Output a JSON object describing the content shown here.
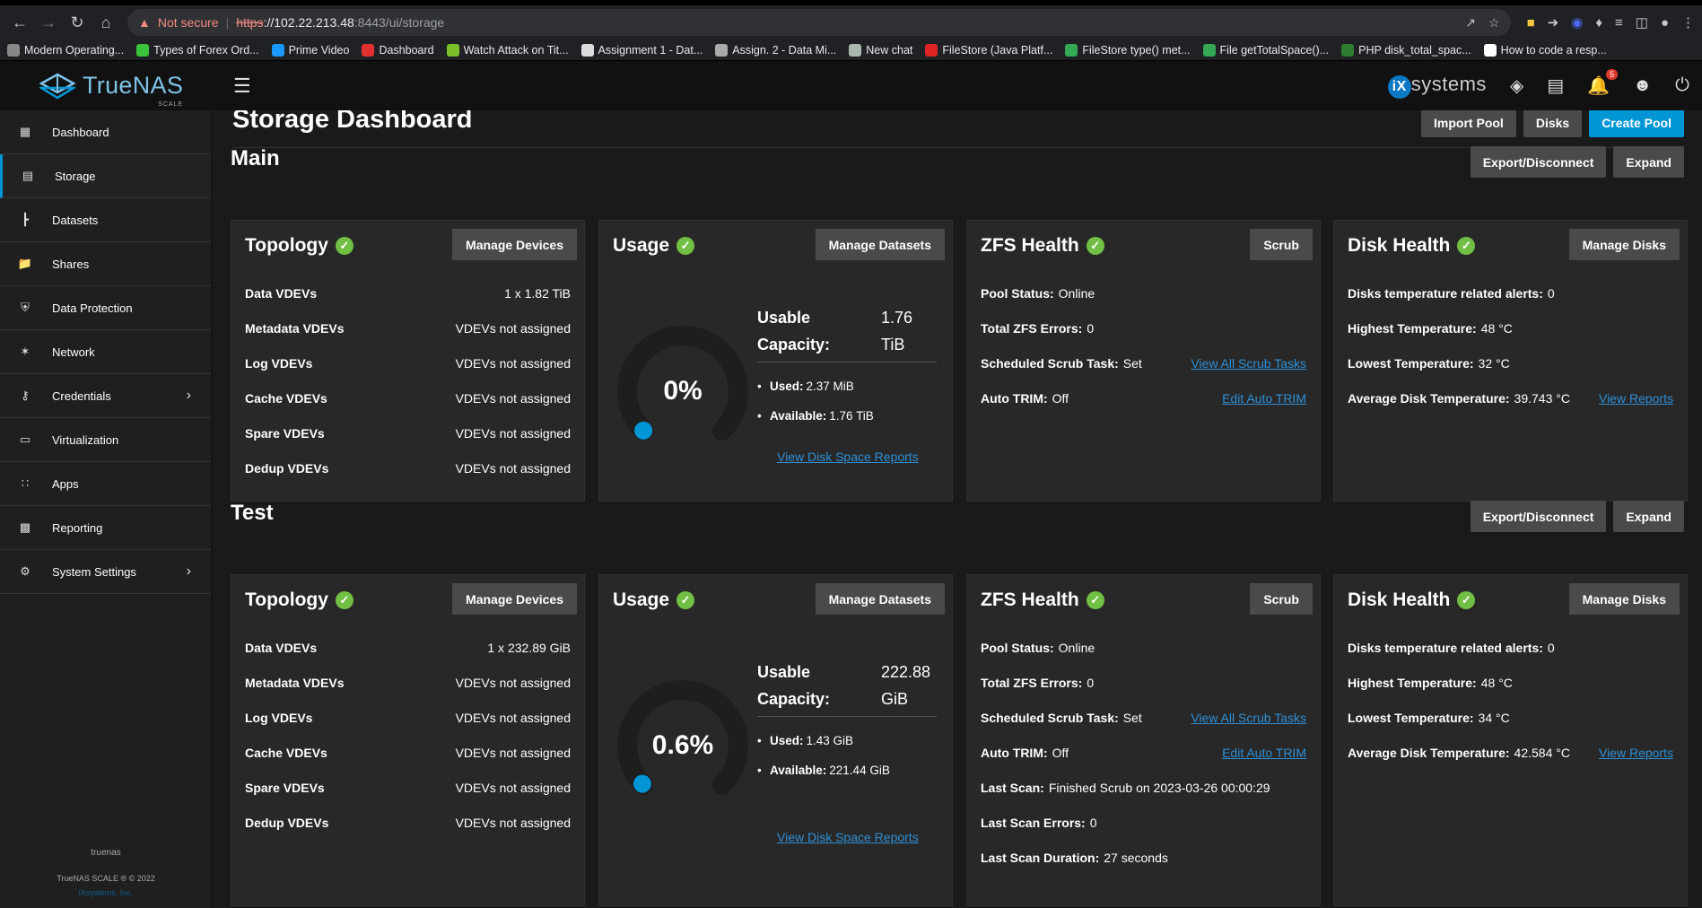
{
  "browser": {
    "not_secure": "Not secure",
    "url_proto": "https",
    "url_host": "://102.22.213.48",
    "url_rest": ":8443/ui/storage",
    "bookmarks": [
      {
        "label": "Modern Operating...",
        "color": "#888888"
      },
      {
        "label": "Types of Forex Ord...",
        "color": "#3ac23a"
      },
      {
        "label": "Prime Video",
        "color": "#1a98ff"
      },
      {
        "label": "Dashboard",
        "color": "#e03030"
      },
      {
        "label": "Watch Attack on Tit...",
        "color": "#7bbf2a"
      },
      {
        "label": "Assignment 1 - Dat...",
        "color": "#dddddd"
      },
      {
        "label": "Assign. 2 - Data Mi...",
        "color": "#aaaaaa"
      },
      {
        "label": "New chat",
        "color": "#aab8b0"
      },
      {
        "label": "FileStore (Java Platf...",
        "color": "#e02424"
      },
      {
        "label": "FileStore type() met...",
        "color": "#34a853"
      },
      {
        "label": "File getTotalSpace()...",
        "color": "#34a853"
      },
      {
        "label": "PHP disk_total_spac...",
        "color": "#2e7d32"
      },
      {
        "label": "How to code a resp...",
        "color": "#ffffff"
      }
    ]
  },
  "header": {
    "logo": "TrueNAS",
    "logo_sub": "SCALE",
    "ix_brand": "systems",
    "ix_mark": "iX",
    "notification_count": "5"
  },
  "sidebar": {
    "items": [
      {
        "label": "Dashboard",
        "icon": "dashboard-icon"
      },
      {
        "label": "Storage",
        "icon": "storage-icon"
      },
      {
        "label": "Datasets",
        "icon": "datasets-icon"
      },
      {
        "label": "Shares",
        "icon": "shares-icon"
      },
      {
        "label": "Data Protection",
        "icon": "shield-icon"
      },
      {
        "label": "Network",
        "icon": "network-icon"
      },
      {
        "label": "Credentials",
        "icon": "key-icon"
      },
      {
        "label": "Virtualization",
        "icon": "monitor-icon"
      },
      {
        "label": "Apps",
        "icon": "apps-icon"
      },
      {
        "label": "Reporting",
        "icon": "chart-icon"
      },
      {
        "label": "System Settings",
        "icon": "gear-icon"
      }
    ],
    "footer_host": "truenas",
    "footer_version": "TrueNAS SCALE ® © 2022",
    "footer_company": "iXsystems, Inc."
  },
  "page": {
    "title": "Storage Dashboard",
    "import_pool": "Import Pool",
    "disks": "Disks",
    "create_pool": "Create Pool"
  },
  "labels": {
    "export": "Export/Disconnect",
    "expand": "Expand",
    "topology": "Topology",
    "usage": "Usage",
    "zfs_health": "ZFS Health",
    "disk_health": "Disk Health",
    "manage_devices": "Manage Devices",
    "manage_datasets": "Manage Datasets",
    "scrub": "Scrub",
    "manage_disks": "Manage Disks",
    "usable": "Usable",
    "capacity": "Capacity:",
    "used": "Used:",
    "available": "Available:",
    "view_disk_space": "View Disk Space Reports",
    "pool_status": "Pool Status:",
    "total_errors": "Total ZFS Errors:",
    "sched_scrub": "Scheduled Scrub Task:",
    "view_scrub": "View All Scrub Tasks",
    "auto_trim": "Auto TRIM:",
    "edit_trim": "Edit Auto TRIM",
    "last_scan": "Last Scan:",
    "last_scan_errors": "Last Scan Errors:",
    "last_scan_duration": "Last Scan Duration:",
    "temp_alerts": "Disks temperature related alerts:",
    "highest": "Highest Temperature:",
    "lowest": "Lowest Temperature:",
    "average": "Average Disk Temperature:",
    "view_reports": "View Reports",
    "vdev_labels": [
      "Data VDEVs",
      "Metadata VDEVs",
      "Log VDEVs",
      "Cache VDEVs",
      "Spare VDEVs",
      "Dedup VDEVs"
    ]
  },
  "pools": [
    {
      "name": "Main",
      "vdevs": [
        "1 x 1.82 TiB",
        "VDEVs not assigned",
        "VDEVs not assigned",
        "VDEVs not assigned",
        "VDEVs not assigned",
        "VDEVs not assigned"
      ],
      "usage_pct": "0%",
      "usage_fraction": 0,
      "usable_value": "1.76",
      "usable_unit": "TiB",
      "used": "2.37 MiB",
      "available": "1.76 TiB",
      "pool_status": "Online",
      "total_errors": "0",
      "sched_scrub": "Set",
      "auto_trim": "Off",
      "temp_alerts": "0",
      "highest": "48 °C",
      "lowest": "32 °C",
      "average": "39.743 °C"
    },
    {
      "name": "Test",
      "vdevs": [
        "1 x 232.89 GiB",
        "VDEVs not assigned",
        "VDEVs not assigned",
        "VDEVs not assigned",
        "VDEVs not assigned",
        "VDEVs not assigned"
      ],
      "usage_pct": "0.6%",
      "usage_fraction": 0.006,
      "usable_value": "222.88",
      "usable_unit": "GiB",
      "used": "1.43 GiB",
      "available": "221.44 GiB",
      "pool_status": "Online",
      "total_errors": "0",
      "sched_scrub": "Set",
      "auto_trim": "Off",
      "last_scan": "Finished Scrub on 2023-03-26 00:00:29",
      "last_scan_errors": "0",
      "last_scan_duration": "27 seconds",
      "temp_alerts": "0",
      "highest": "48 °C",
      "lowest": "34 °C",
      "average": "42.584 °C"
    }
  ],
  "colors": {
    "accent": "#0095d5",
    "ok": "#71bf44",
    "link": "#2e8fd6"
  }
}
